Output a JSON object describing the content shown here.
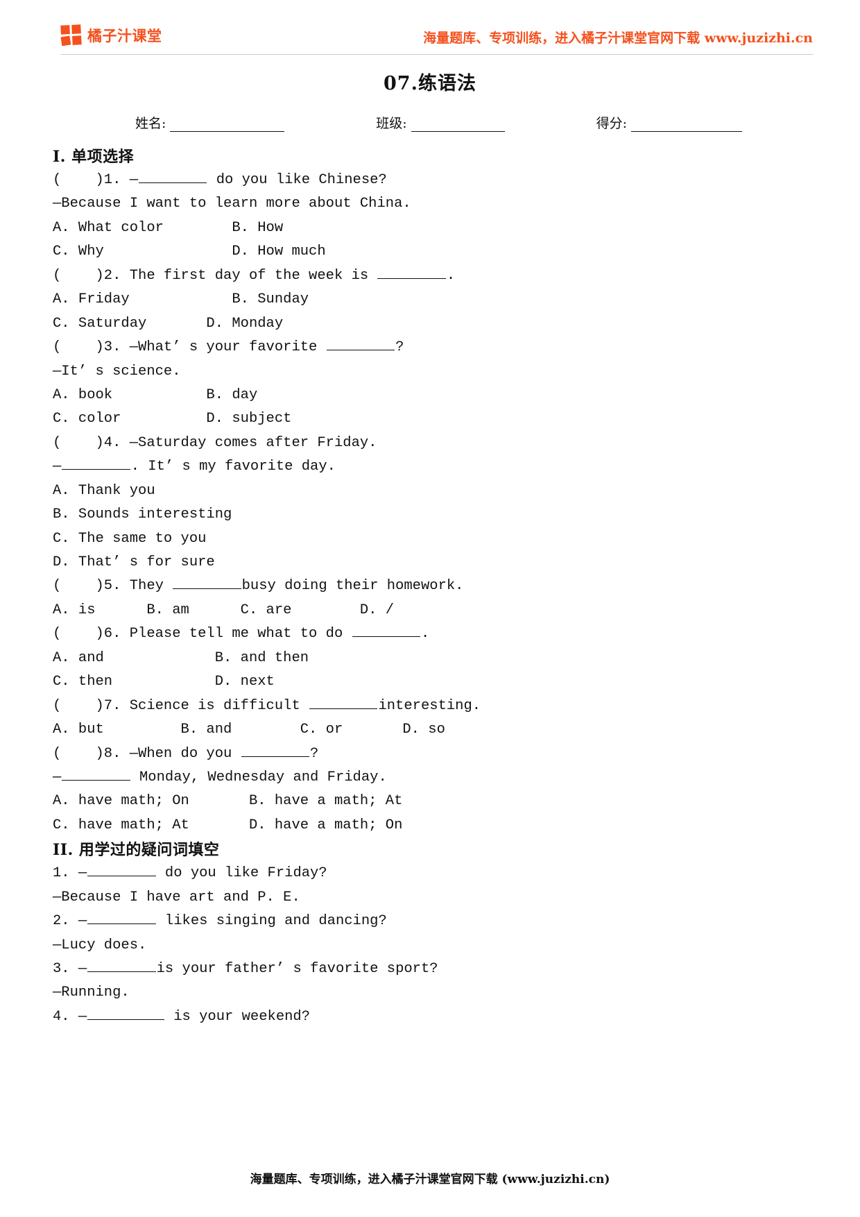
{
  "header": {
    "brand_name": "橘子汁课堂",
    "promo_text": "海量题库、专项训练，进入橘子汁课堂官网下载 www.juzizhi.cn"
  },
  "title": "07.练语法",
  "meta": [
    {
      "label": "姓名:",
      "value": ""
    },
    {
      "label": "班级:",
      "value": ""
    },
    {
      "label": "得分:",
      "value": ""
    }
  ],
  "sections": [
    {
      "heading": "I. 单项选择",
      "lines": [
        "(    )1. —________ do you like Chinese?",
        "—Because I want to learn more about China.",
        "A. What color        B. How",
        "C. Why               D. How much",
        "(    )2. The first day of the week is ________.",
        "A. Friday            B. Sunday",
        "C. Saturday       D. Monday",
        "(    )3. —What’ s your favorite ________?",
        "—It’ s science.",
        "A. book           B. day",
        "C. color          D. subject",
        "(    )4. —Saturday comes after Friday.",
        "—________. It’ s my favorite day.",
        "A. Thank you",
        "B. Sounds interesting",
        "C. The same to you",
        "D. That’ s for sure",
        "(    )5. They ________busy doing their homework.",
        "A. is      B. am      C. are        D. /",
        "(    )6. Please tell me what to do ________.",
        "A. and             B. and then",
        "C. then            D. next",
        "(    )7. Science is difficult ________interesting.",
        "A. but         B. and        C. or       D. so",
        "(    )8. —When do you ________?",
        "—________ Monday, Wednesday and Friday.",
        "A. have math; On       B. have a math; At",
        "C. have math; At       D. have a math; On"
      ]
    },
    {
      "heading": "II. 用学过的疑问词填空",
      "lines": [
        "1. —________ do you like Friday?",
        "—Because I have art and P. E.",
        "2. —________ likes singing and dancing?",
        "—Lucy does.",
        "3. —________is your father’ s favorite sport?",
        "—Running.",
        "4. —_________ is your weekend?"
      ]
    }
  ],
  "footer": {
    "text": "海量题库、专项训练，进入橘子汁课堂官网下载 (www.juzizhi.cn)"
  },
  "colors": {
    "brand_orange": "#f4511e",
    "text": "#111111",
    "rule": "#c9c9c9"
  }
}
